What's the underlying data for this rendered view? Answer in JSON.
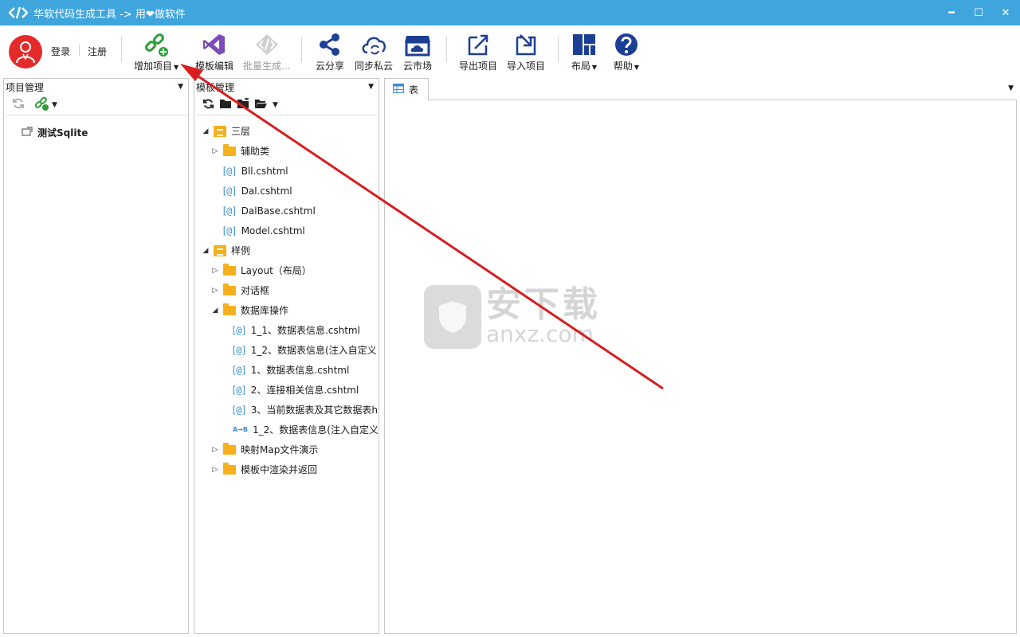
{
  "window": {
    "title": "华软代码生成工具 -> 用❤做软件",
    "controls": {
      "minimize": "━",
      "maximize": "☐",
      "close": "✕"
    }
  },
  "toolbar": {
    "login": "登录",
    "register": "注册",
    "add_project": "增加项目",
    "template_edit": "模板编辑",
    "batch_generate": "批量生成...",
    "cloud_share": "云分享",
    "sync_private_cloud": "同步私云",
    "cloud_market": "云市场",
    "export_project": "导出项目",
    "import_project": "导入项目",
    "layout": "布局",
    "help": "帮助"
  },
  "project_panel": {
    "title": "项目管理",
    "items": [
      {
        "label": "测试Sqlite"
      }
    ]
  },
  "template_panel": {
    "title": "模板管理",
    "tree": [
      {
        "label": "三层"
      },
      {
        "label": "辅助类"
      },
      {
        "label": "Bll.cshtml"
      },
      {
        "label": "Dal.cshtml"
      },
      {
        "label": "DalBase.cshtml"
      },
      {
        "label": "Model.cshtml"
      },
      {
        "label": "样例"
      },
      {
        "label": "Layout（布局）"
      },
      {
        "label": "对话框"
      },
      {
        "label": "数据库操作"
      },
      {
        "label": "1_1、数据表信息.cshtml"
      },
      {
        "label": "1_2、数据表信息(注入自定义"
      },
      {
        "label": "1、数据表信息.cshtml"
      },
      {
        "label": "2、连接相关信息.cshtml"
      },
      {
        "label": "3、当前数据表及其它数据表h"
      },
      {
        "label": "1_2、数据表信息(注入自定义"
      },
      {
        "label": "映射Map文件演示"
      },
      {
        "label": "模板中渲染并返回"
      }
    ],
    "at_icon": "[@]",
    "ab_icon": "A→B"
  },
  "document": {
    "tab_label": "表"
  },
  "watermark": {
    "cn": "安下载",
    "en": "anxz.com"
  },
  "colors": {
    "titlebar": "#3fa6dd",
    "folder": "#f6b01e",
    "avatar": "#e52a2a",
    "arrow": "#d81e1e",
    "accent_green": "#2e9e3a",
    "vs_purple": "#7b4bb7",
    "nav_blue": "#1c3f94"
  }
}
